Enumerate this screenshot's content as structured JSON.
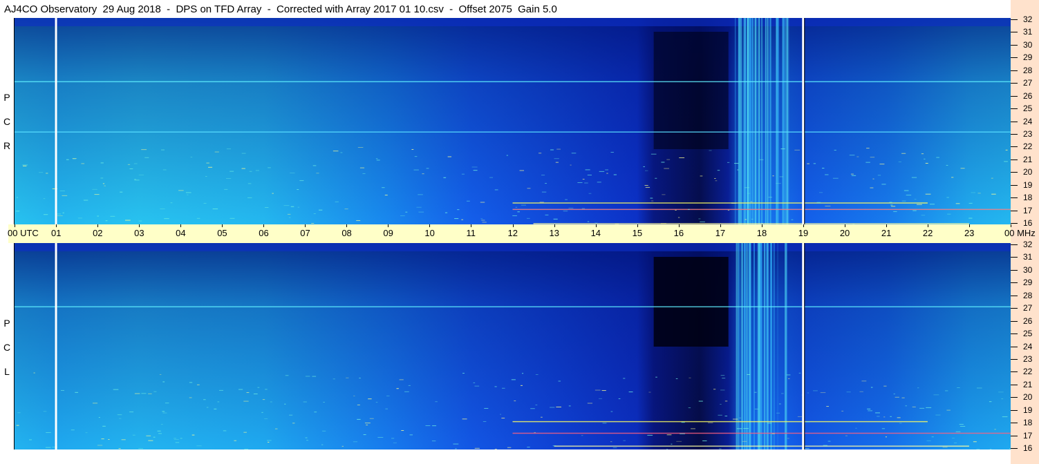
{
  "title": "AJ4CO Observatory  29 Aug 2018  -  DPS on TFD Array  -  Corrected with Array 2017 01 10.csv  -  Offset 2075  Gain 5.0",
  "panels": {
    "rcp_label": [
      "R",
      "C",
      "P"
    ],
    "lcp_label": [
      "L",
      "C",
      "P"
    ]
  },
  "time_axis": {
    "labels": [
      "00 UTC",
      "01",
      "02",
      "03",
      "04",
      "05",
      "06",
      "07",
      "08",
      "09",
      "10",
      "11",
      "12",
      "13",
      "14",
      "15",
      "16",
      "17",
      "18",
      "19",
      "20",
      "21",
      "22",
      "23",
      "00 MHz"
    ]
  },
  "freq_axis": {
    "labels": [
      "32",
      "31",
      "30",
      "29",
      "28",
      "27",
      "26",
      "25",
      "24",
      "23",
      "22",
      "21",
      "20",
      "19",
      "18",
      "17",
      "16"
    ]
  },
  "colors": {
    "deep": "#000000",
    "dark_blue": "#0a1fb0",
    "blue": "#1450e6",
    "mid": "#1a8cf0",
    "cyan": "#22bff0",
    "light": "#3fe0e8",
    "axis_bg": "#ffffc8",
    "side_bg": "#ffe2cc"
  },
  "chart_data": {
    "type": "heatmap",
    "title": "AJ4CO Observatory  29 Aug 2018  -  DPS on TFD Array  -  Corrected with Array 2017 01 10.csv  -  Offset 2075  Gain 5.0",
    "panels": [
      "RCP",
      "LCP"
    ],
    "x_unit": "UTC hours",
    "y_unit": "MHz",
    "xlim": [
      0,
      24
    ],
    "ylim": [
      16,
      32
    ],
    "intensity_profile_hours": [
      0,
      1,
      3,
      6,
      9,
      11,
      13,
      15,
      15.4,
      16.5,
      17.2,
      17.6,
      18.6,
      19,
      21,
      23,
      24
    ],
    "intensity_profile_levels": [
      0.85,
      0.8,
      0.85,
      0.8,
      0.6,
      0.45,
      0.35,
      0.25,
      0.1,
      0.05,
      0.15,
      0.55,
      0.5,
      0.45,
      0.55,
      0.75,
      0.8
    ],
    "vertical_markers_hours": [
      1,
      19
    ]
  }
}
